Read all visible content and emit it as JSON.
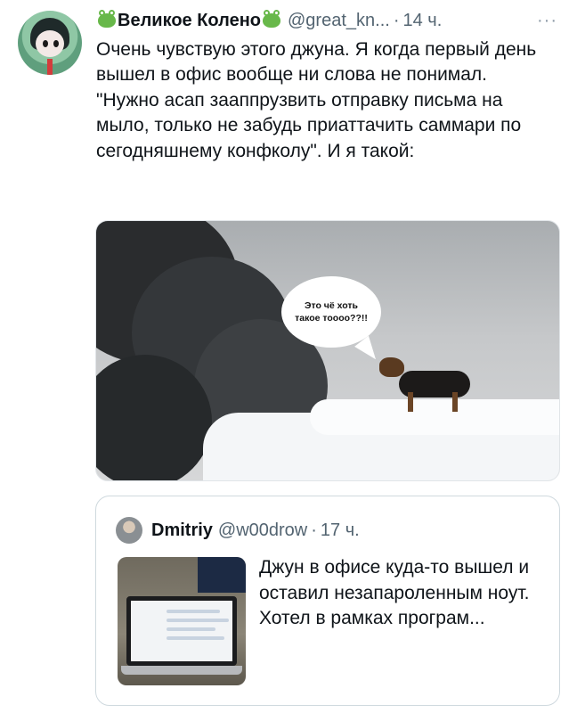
{
  "tweet": {
    "author_name": "Великое Колено",
    "handle": "@great_kn...",
    "separator": "·",
    "time": "14 ч.",
    "more_icon": "···",
    "text": "Очень чувствую этого джуна. Я когда первый день вышел в офис вообще ни слова не понимал. \"Нужно асап зааппрузвить отправку письма на мыло, только не забудь приаттачить саммари по сегодняшнему конфколу\". И я такой:",
    "image": {
      "bubble_line1": "Это чё хоть",
      "bubble_line2": "такое тоооо??!!"
    }
  },
  "quoted_tweet": {
    "author_name": "Dmitriy",
    "handle": "@w00drow",
    "separator": "·",
    "time": "17 ч.",
    "text": "Джун в офисе куда-то вышел и оставил незапароленным ноут. Хотел в рамках програм..."
  },
  "icons": {
    "name_emoji": "frog-icon",
    "more": "more-options-icon"
  }
}
